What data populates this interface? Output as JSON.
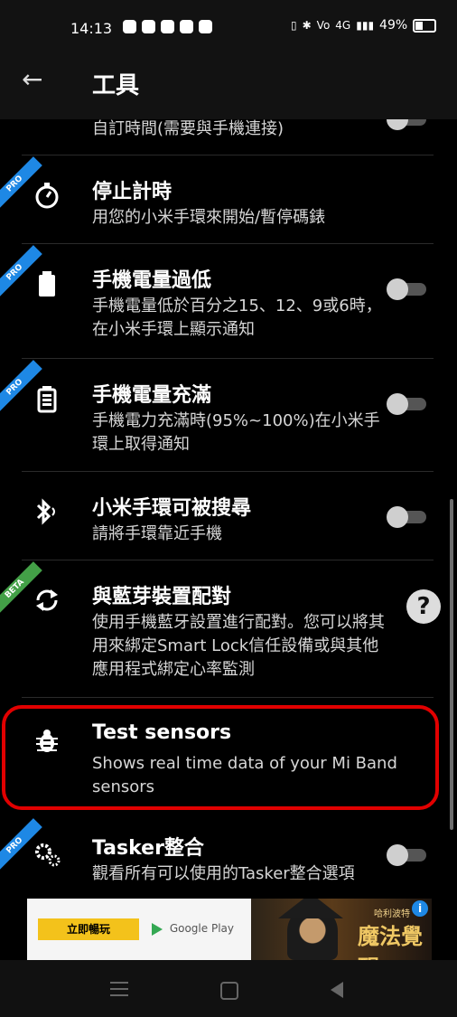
{
  "status_bar": {
    "time": "14:13",
    "battery_percent": "49%",
    "network_label": "4G"
  },
  "app_bar": {
    "title": "工具",
    "back_icon": "arrow-left-icon"
  },
  "rows": [
    {
      "title": "",
      "subtitle": "自訂時間(需要與手機連接)",
      "badge": "",
      "icon": "",
      "has_toggle": true,
      "toggle_on": false
    },
    {
      "title": "停止計時",
      "subtitle": "用您的小米手環來開始/暫停碼錶",
      "badge": "PRO",
      "icon": "stopwatch-icon",
      "has_toggle": false
    },
    {
      "title": "手機電量過低",
      "subtitle": "手機電量低於百分之15、12、9或6時，在小米手環上顯示通知",
      "badge": "PRO",
      "icon": "battery-low-icon",
      "has_toggle": true,
      "toggle_on": false
    },
    {
      "title": "手機電量充滿",
      "subtitle": "手機電力充滿時(95%~100%)在小米手環上取得通知",
      "badge": "PRO",
      "icon": "battery-full-icon",
      "has_toggle": true,
      "toggle_on": false
    },
    {
      "title": "小米手環可被搜尋",
      "subtitle": "請將手環靠近手機",
      "badge": "",
      "icon": "bluetooth-audio-icon",
      "has_toggle": true,
      "toggle_on": false
    },
    {
      "title": "與藍芽裝置配對",
      "subtitle": "使用手機藍牙設置進行配對。您可以將其用來綁定Smart Lock信任設備或與其他應用程式綁定心率監測",
      "badge": "BETA",
      "icon": "sync-icon",
      "has_toggle": false,
      "help": "?"
    },
    {
      "title": "Test sensors",
      "subtitle": "Shows real time data of your Mi Band sensors",
      "badge": "",
      "icon": "bug-icon",
      "has_toggle": false
    },
    {
      "title": "Tasker整合",
      "subtitle": "觀看所有可以使用的Tasker整合選項",
      "badge": "PRO",
      "icon": "gears-icon",
      "has_toggle": true,
      "toggle_on": false
    }
  ],
  "ad": {
    "cta": "立即暢玩",
    "store": "Google Play",
    "game_small": "哈利波特",
    "game_title": "魔法覺醒",
    "info": "i"
  },
  "colors": {
    "background": "#000000",
    "pro_badge": "#1e88e5",
    "beta_badge": "#43a047",
    "highlight": "#e10000",
    "toggle_track": "#555555",
    "toggle_thumb": "#cfcfcf"
  }
}
